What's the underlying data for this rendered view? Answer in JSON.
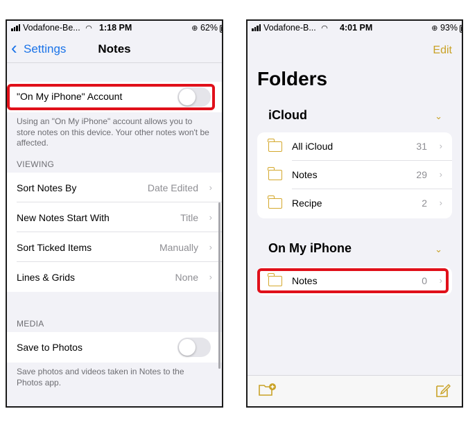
{
  "left_phone": {
    "status": {
      "carrier": "Vodafone-Be...",
      "time": "1:18 PM",
      "battery": "62%",
      "battery_level": 0.62
    },
    "nav": {
      "back_label": "Settings",
      "title": "Notes"
    },
    "account": {
      "label": "\"On My iPhone\" Account",
      "enabled": false,
      "footnote": "Using an \"On My iPhone\" account allows you to store notes on this device. Your other notes won't be affected."
    },
    "viewing": {
      "header": "VIEWING",
      "rows": [
        {
          "label": "Sort Notes By",
          "value": "Date Edited"
        },
        {
          "label": "New Notes Start With",
          "value": "Title"
        },
        {
          "label": "Sort Ticked Items",
          "value": "Manually"
        },
        {
          "label": "Lines & Grids",
          "value": "None"
        }
      ]
    },
    "media": {
      "header": "MEDIA",
      "save_label": "Save to Photos",
      "enabled": false,
      "footnote": "Save photos and videos taken in Notes to the Photos app."
    }
  },
  "right_phone": {
    "status": {
      "carrier": "Vodafone-B...",
      "time": "4:01 PM",
      "battery": "93%",
      "battery_level": 0.93
    },
    "edit_label": "Edit",
    "title": "Folders",
    "icloud": {
      "title": "iCloud",
      "folders": [
        {
          "name": "All iCloud",
          "count": "31"
        },
        {
          "name": "Notes",
          "count": "29"
        },
        {
          "name": "Recipe",
          "count": "2"
        }
      ]
    },
    "on_my_iphone": {
      "title": "On My iPhone",
      "folders": [
        {
          "name": "Notes",
          "count": "0"
        }
      ]
    }
  },
  "colors": {
    "accent_blue": "#1a73e8",
    "accent_yellow": "#c9a227",
    "highlight_red": "#e0101a"
  },
  "icons": {
    "back": "chevron-left-icon",
    "disclosure": "chevron-right-icon",
    "collapse": "chevron-down-icon",
    "folder": "folder-icon",
    "new_folder": "new-folder-icon",
    "compose": "compose-icon"
  }
}
